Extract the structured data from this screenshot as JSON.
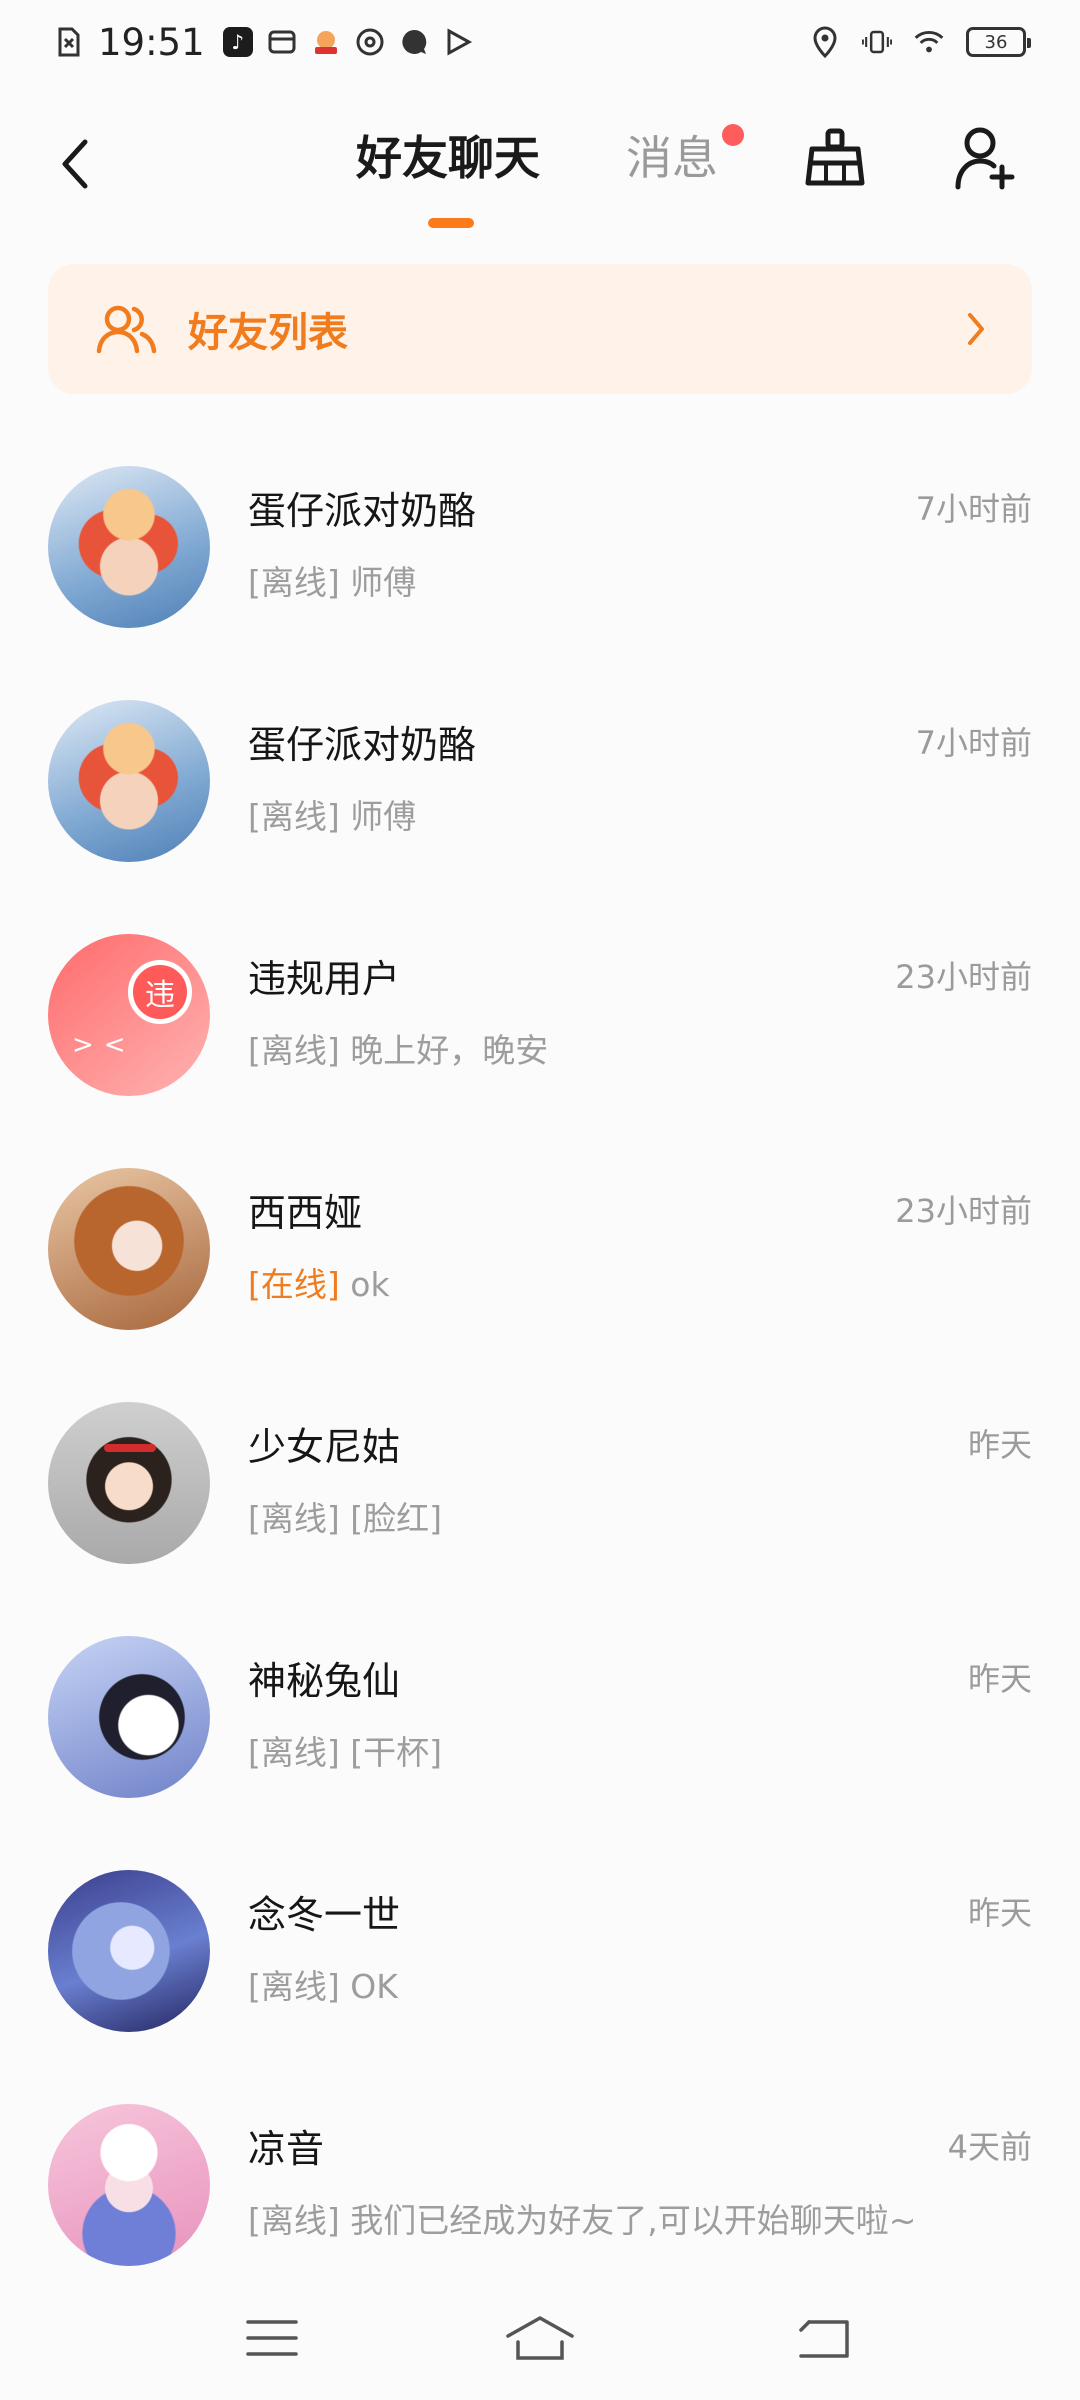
{
  "status_bar": {
    "time": "19:51",
    "battery": "36",
    "icons": [
      "sim-icon",
      "tiktok-icon",
      "wallet-icon",
      "game-icon",
      "at-icon",
      "chat-icon",
      "video-icon",
      "location-icon",
      "vibrate-icon",
      "wifi-icon",
      "battery-icon"
    ]
  },
  "header": {
    "back_icon": "chevron-left-icon",
    "tabs": [
      {
        "label": "好友聊天",
        "active": true
      },
      {
        "label": "消息",
        "active": false,
        "has_dot": true
      }
    ],
    "clean_icon": "broom-icon",
    "add_friend_icon": "add-user-icon",
    "accent_color": "#fd7a1b"
  },
  "banner": {
    "label": "好友列表",
    "icon": "friends-icon",
    "chevron_icon": "chevron-right-icon"
  },
  "chats": [
    {
      "name": "蛋仔派对奶酪",
      "time": "7小时前",
      "status": "[离线]",
      "online": false,
      "message": "师傅"
    },
    {
      "name": "蛋仔派对奶酪",
      "time": "7小时前",
      "status": "[离线]",
      "online": false,
      "message": "师傅"
    },
    {
      "name": "违规用户",
      "time": "23小时前",
      "status": "[离线]",
      "online": false,
      "message": "晚上好，晚安",
      "avatar_badge": "违"
    },
    {
      "name": "西西娅",
      "time": "23小时前",
      "status": "[在线]",
      "online": true,
      "message": "ok"
    },
    {
      "name": "少女尼姑",
      "time": "昨天",
      "status": "[离线]",
      "online": false,
      "message": "[脸红]"
    },
    {
      "name": "神秘兔仙",
      "time": "昨天",
      "status": "[离线]",
      "online": false,
      "message": "[干杯]"
    },
    {
      "name": "念冬一世",
      "time": "昨天",
      "status": "[离线]",
      "online": false,
      "message": "OK"
    },
    {
      "name": "凉音",
      "time": "4天前",
      "status": "[离线]",
      "online": false,
      "message": "我们已经成为好友了,可以开始聊天啦~"
    }
  ],
  "nav_bar": {
    "icons": [
      "menu-icon",
      "home-icon",
      "back-icon"
    ]
  }
}
